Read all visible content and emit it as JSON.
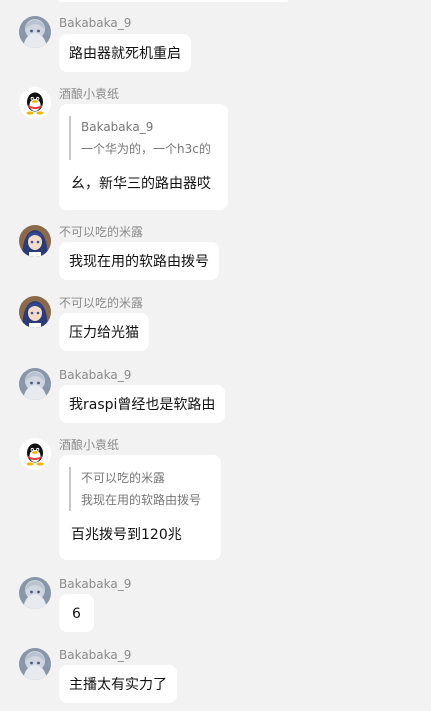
{
  "messages": [
    {
      "sender": "Bakabaka_9",
      "avatar": "anime-girl-silver-avatar",
      "text": "路由器就死机重启"
    },
    {
      "sender": "酒酿小袁纸",
      "avatar": "qq-penguin-avatar",
      "quote": {
        "author": "Bakabaka_9",
        "text": "一个华为的，一个h3c的"
      },
      "text": "幺，新华三的路由器哎"
    },
    {
      "sender": "不可以吃的米露",
      "avatar": "anime-girl-blue-hair-avatar",
      "text": "我现在用的软路由拨号"
    },
    {
      "sender": "不可以吃的米露",
      "avatar": "anime-girl-blue-hair-avatar",
      "text": "压力给光猫"
    },
    {
      "sender": "Bakabaka_9",
      "avatar": "anime-girl-silver-avatar",
      "text": "我raspi曾经也是软路由"
    },
    {
      "sender": "酒酿小袁纸",
      "avatar": "qq-penguin-avatar",
      "quote": {
        "author": "不可以吃的米露",
        "text": "我现在用的软路由拨号"
      },
      "text": "百兆拨号到120兆"
    },
    {
      "sender": "Bakabaka_9",
      "avatar": "anime-girl-silver-avatar",
      "text": "6"
    },
    {
      "sender": "Bakabaka_9",
      "avatar": "anime-girl-silver-avatar",
      "text": "主播太有实力了"
    }
  ],
  "colors": {
    "background": "#f2f2f2",
    "bubble": "#ffffff",
    "name": "#8a8a8a",
    "quote_bar": "#c8c8c8"
  }
}
